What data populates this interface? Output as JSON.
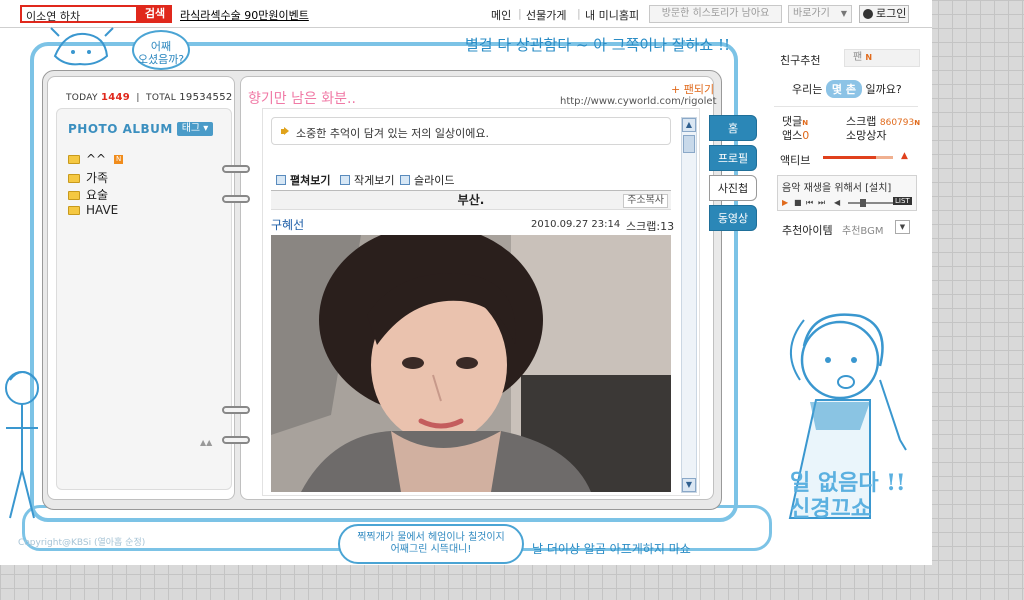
{
  "topbar": {
    "search_value": "이소연 하차",
    "search_button": "검색",
    "promo_link": "라식라섹수술 90만원이벤트",
    "nav": [
      "메인",
      "선물가게",
      "내 미니홈피"
    ],
    "visit_history": "방문한 히스토리가 남아요",
    "goto_label": "바로가기",
    "login_label": "로그인"
  },
  "decoration": {
    "top_cloud": "어째\n오셨음까?",
    "top_phrase": "별걸 다 상관함다 ~ 아 그쪽이나 잘하쇼 !!",
    "bottom_cloud": "찍찍개가 물에서 헤엄이나 칠것이지\n어째그린 시뜩대니!",
    "bottom_phrase": "날 더이상 알곰 아프게하지 마쇼",
    "right_phrase": "일 없음다 !!\n신경끄쇼"
  },
  "header": {
    "today_label": "TODAY",
    "today_count": "1449",
    "total_label": "TOTAL",
    "total_count": "19534552",
    "title": "향기만 남은 화분..",
    "fan_button": "팬되기",
    "url": "http://www.cyworld.com/rigolet"
  },
  "album": {
    "title": "PHOTO ALBUM",
    "tag_button": "태그",
    "folders": [
      {
        "label": "^^",
        "new": "N"
      },
      {
        "label": "가족"
      },
      {
        "label": "요술"
      },
      {
        "label": "HAVE"
      }
    ]
  },
  "content": {
    "notice": "소중한 추억이 담겨 있는 저의 일상이에요.",
    "view_options": [
      "펼쳐보기",
      "작게보기",
      "슬라이드"
    ],
    "post_title": "부산.",
    "copy_address": "주소복사",
    "author": "구혜선",
    "date": "2010.09.27 23:14",
    "scrap": "스크랩:13"
  },
  "tabs": [
    "홈",
    "프로필",
    "사진첩",
    "동영상"
  ],
  "right_panel": {
    "friend_recommend": "친구추천",
    "fan_label": "팬",
    "fan_new": "N",
    "mystery_prefix": "우리는",
    "mystery_badge": "몇 촌",
    "mystery_suffix": "일까요?",
    "comment_label": "댓글",
    "comment_new": "N",
    "scrap_label": "스크랩",
    "scrap_count": "860793",
    "scrap_new": "N",
    "apps_label": "앱스",
    "apps_count": "0",
    "wish_box": "소망상자",
    "active_label": "액티브",
    "active_level": 0.75,
    "music_text": "음악 재생을 위해서 [설치]",
    "list_button": "LIST",
    "rec_item": "추천아이템",
    "rec_bgm": "추천BGM"
  },
  "copyright": "Copyright@KBSi (열아홉 순정)",
  "colors": {
    "accent_blue": "#2b87b7",
    "brand_red": "#e0281c",
    "pink_title": "#f07aa6",
    "frame_blue": "#7cc3e6"
  }
}
